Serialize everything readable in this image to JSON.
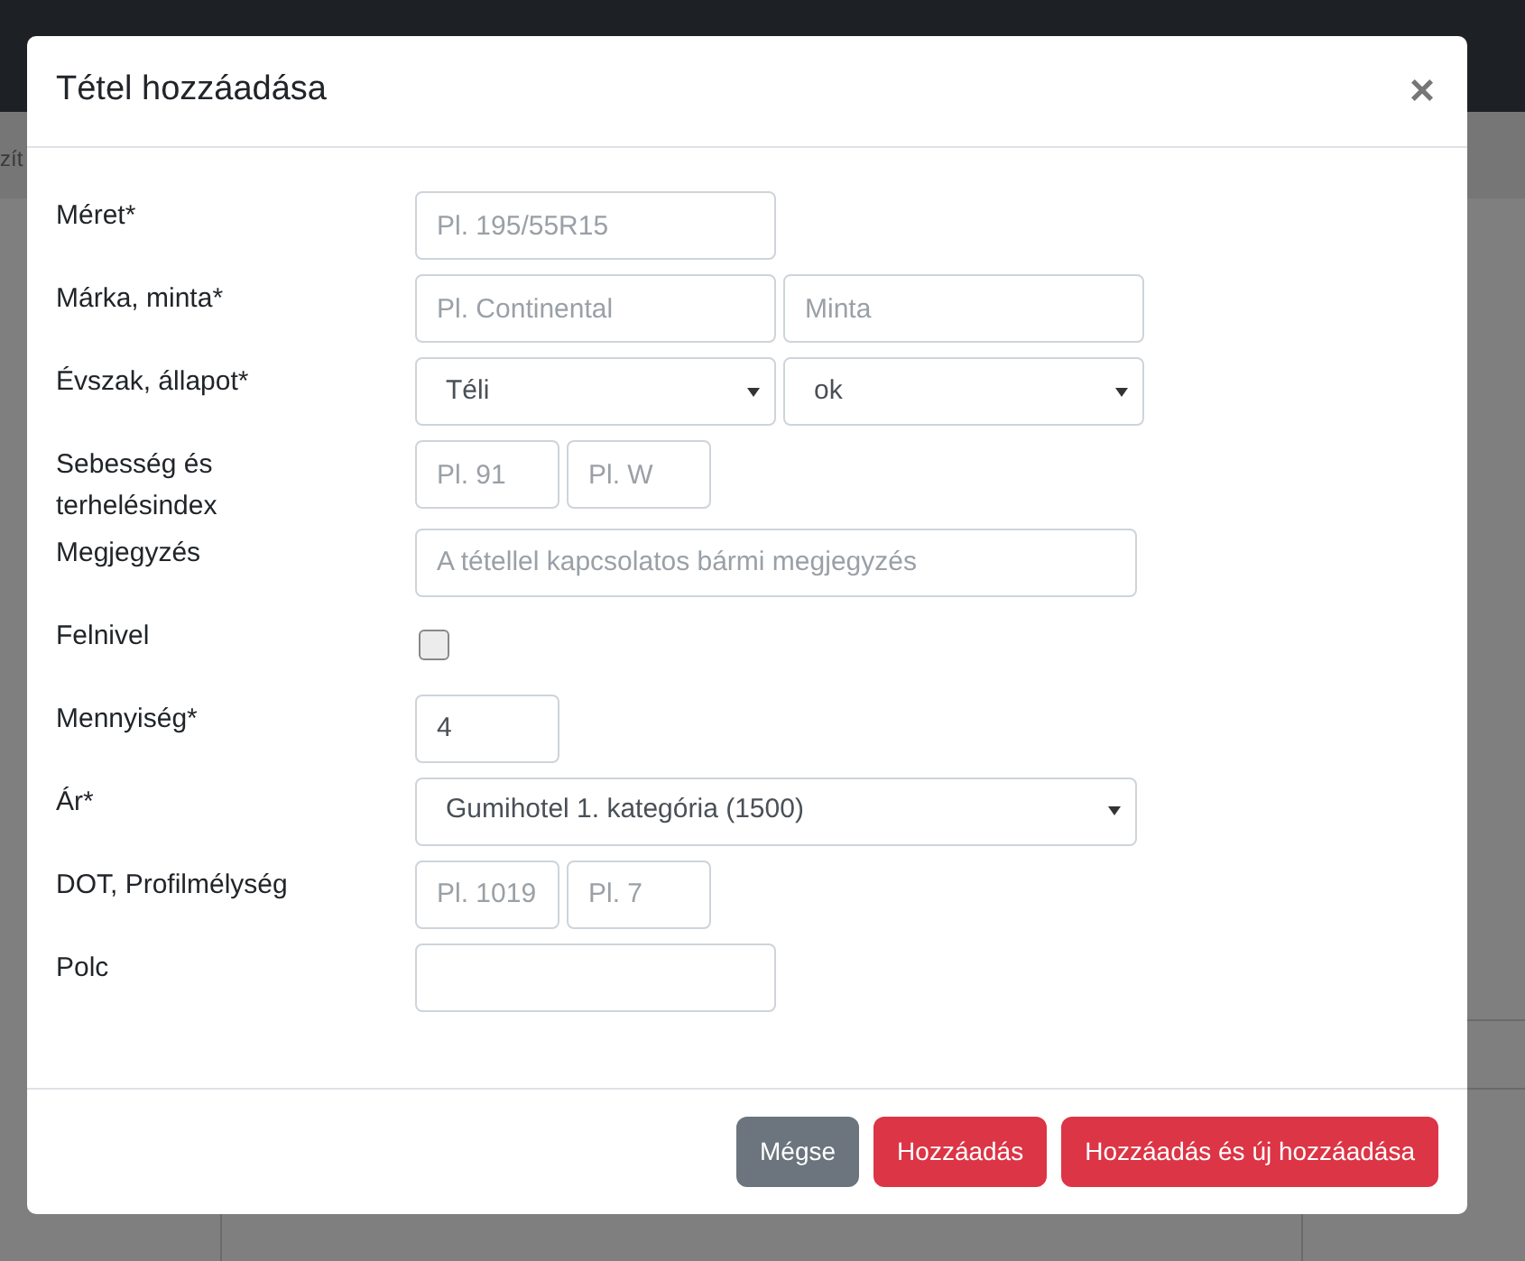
{
  "background": {
    "fragment": "zít"
  },
  "dialog": {
    "title": "Tétel hozzáadása",
    "close": "×"
  },
  "rows": [
    {
      "label": "Méret*",
      "controls": [
        {
          "kind": "field",
          "placeholder": "Pl. 195/55R15"
        }
      ]
    },
    {
      "label": "Márka, minta*",
      "controls": [
        {
          "kind": "field",
          "placeholder": "Pl. Continental"
        },
        {
          "kind": "field",
          "placeholder": "Minta"
        }
      ]
    },
    {
      "label": "Évszak, állapot*",
      "controls": [
        {
          "kind": "select",
          "value": "Téli"
        },
        {
          "kind": "select",
          "value": "ok"
        }
      ]
    },
    {
      "label": "Sebesség és terhelésindex",
      "controls": [
        {
          "kind": "shortfield",
          "placeholder": "Pl. 91"
        },
        {
          "kind": "shortfield",
          "placeholder": "Pl. W"
        }
      ]
    },
    {
      "label": "Megjegyzés",
      "controls": [
        {
          "kind": "widefield",
          "placeholder": "A tétellel kapcsolatos bármi megjegyzés"
        }
      ]
    },
    {
      "label": "Felnivel",
      "controls": [
        {
          "kind": "checkbox",
          "checked": false
        }
      ]
    },
    {
      "label": "Mennyiség*",
      "controls": [
        {
          "kind": "shortfield",
          "value": "4"
        }
      ]
    },
    {
      "label": "Ár*",
      "controls": [
        {
          "kind": "wideselect",
          "value": "Gumihotel 1. kategória (1500)"
        }
      ]
    },
    {
      "label": "DOT, Profilmélység",
      "controls": [
        {
          "kind": "shortfield",
          "placeholder": "Pl. 1019"
        },
        {
          "kind": "shortfield",
          "placeholder": "Pl. 7"
        }
      ]
    },
    {
      "label": "Polc",
      "controls": [
        {
          "kind": "field"
        }
      ]
    }
  ],
  "buttons": [
    {
      "label": "Mégse",
      "kind": "secondary"
    },
    {
      "label": "Hozzáadás",
      "kind": "danger"
    },
    {
      "label": "Hozzáadás és új hozzáadása",
      "kind": "danger"
    }
  ]
}
